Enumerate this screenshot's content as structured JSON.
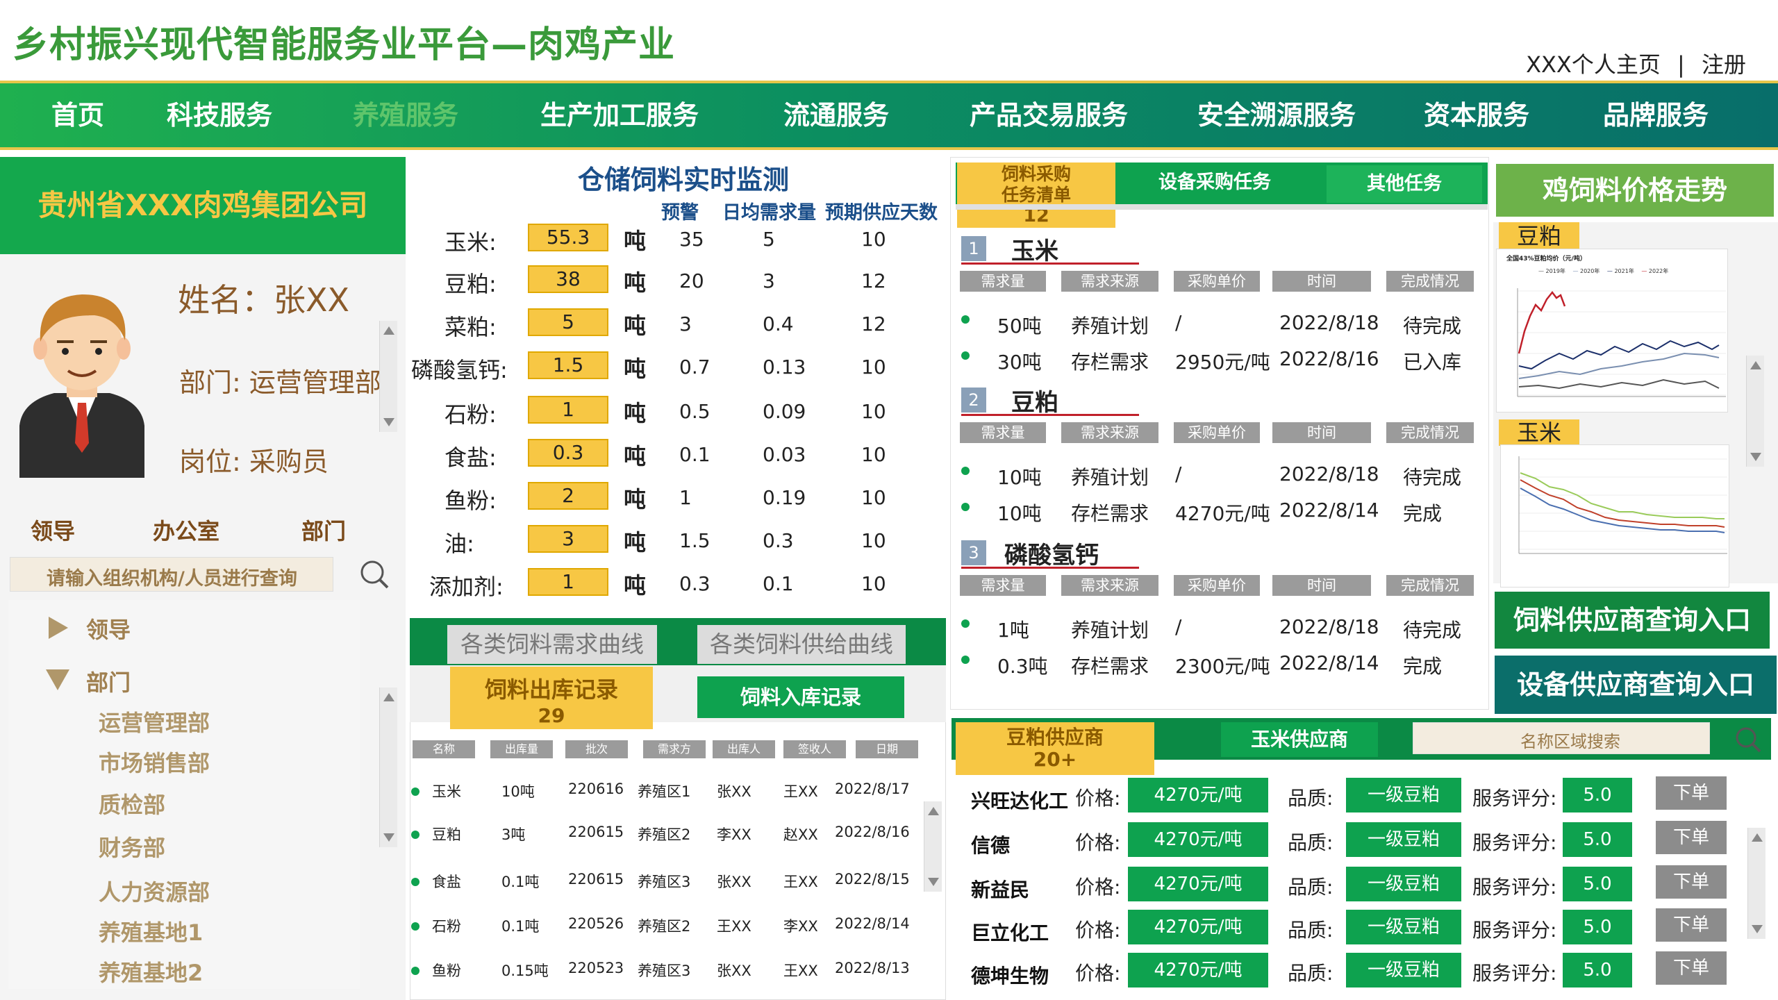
{
  "header": {
    "title": "乡村振兴现代智能服务业平台—肉鸡产业",
    "home_link": "XXX个人主页",
    "separator": "|",
    "register": "注册"
  },
  "nav": [
    "首页",
    "科技服务",
    "养殖服务",
    "生产加工服务",
    "流通服务",
    "产品交易服务",
    "安全溯源服务",
    "资本服务",
    "品牌服务"
  ],
  "company": "贵州省XXX肉鸡集团公司",
  "profile": {
    "name": "姓名：张XX",
    "dept": "部门: 运营管理部",
    "role": "岗位: 采购员"
  },
  "org_tabs": [
    "领导",
    "办公室",
    "部门"
  ],
  "search_placeholder": "请输入组织机构/人员进行查询",
  "tree": {
    "leader": "领导",
    "dept": "部门",
    "children": [
      "运营管理部",
      "市场销售部",
      "质检部",
      "财务部",
      "人力资源部",
      "养殖基地1",
      "养殖基地2"
    ]
  },
  "warehouse": {
    "title": "仓储饲料实时监测",
    "cols": [
      "预警",
      "日均需求量",
      "预期供应天数"
    ],
    "unit": "吨",
    "rows": [
      {
        "name": "玉米:",
        "qty": "55.3",
        "warn": "35",
        "daily": "5",
        "days": "10"
      },
      {
        "name": "豆粕:",
        "qty": "38",
        "warn": "20",
        "daily": "3",
        "days": "12"
      },
      {
        "name": "菜粕:",
        "qty": "5",
        "warn": "3",
        "daily": "0.4",
        "days": "12"
      },
      {
        "name": "磷酸氢钙:",
        "qty": "1.5",
        "warn": "0.7",
        "daily": "0.13",
        "days": "10"
      },
      {
        "name": "石粉:",
        "qty": "1",
        "warn": "0.5",
        "daily": "0.09",
        "days": "10"
      },
      {
        "name": "食盐:",
        "qty": "0.3",
        "warn": "0.1",
        "daily": "0.03",
        "days": "10"
      },
      {
        "name": "鱼粉:",
        "qty": "2",
        "warn": "1",
        "daily": "0.19",
        "days": "10"
      },
      {
        "name": "油:",
        "qty": "3",
        "warn": "1.5",
        "daily": "0.3",
        "days": "10"
      },
      {
        "name": "添加剂:",
        "qty": "1",
        "warn": "0.3",
        "daily": "0.1",
        "days": "10"
      }
    ]
  },
  "curves": {
    "demand": "各类饲料需求曲线",
    "supply": "各类饲料供给曲线"
  },
  "records": {
    "out_tab": "饲料出库记录",
    "out_count": "29",
    "in_tab": "饲料入库记录",
    "cols": [
      "名称",
      "出库量",
      "批次",
      "需求方",
      "出库人",
      "签收人",
      "日期"
    ],
    "rows": [
      [
        "玉米",
        "10吨",
        "220616",
        "养殖区1",
        "张XX",
        "王XX",
        "2022/8/17"
      ],
      [
        "豆粕",
        "3吨",
        "220615",
        "养殖区2",
        "李XX",
        "赵XX",
        "2022/8/16"
      ],
      [
        "食盐",
        "0.1吨",
        "220615",
        "养殖区3",
        "张XX",
        "王XX",
        "2022/8/15"
      ],
      [
        "石粉",
        "0.1吨",
        "220526",
        "养殖区2",
        "王XX",
        "李XX",
        "2022/8/14"
      ],
      [
        "鱼粉",
        "0.15吨",
        "220523",
        "养殖区3",
        "张XX",
        "王XX",
        "2022/8/13"
      ]
    ]
  },
  "tasks": {
    "tab1": "饲料采购\n任务清单",
    "tab1_count": "12",
    "tab2": "设备采购任务",
    "tab3": "其他任务",
    "cols": [
      "需求量",
      "需求来源",
      "采购单价",
      "时间",
      "完成情况"
    ],
    "groups": [
      {
        "num": "1",
        "name": "玉米",
        "rows": [
          [
            "50吨",
            "养殖计划",
            "/",
            "2022/8/18",
            "待完成"
          ],
          [
            "30吨",
            "存栏需求",
            "2950元/吨",
            "2022/8/16",
            "已入库"
          ]
        ]
      },
      {
        "num": "2",
        "name": "豆粕",
        "rows": [
          [
            "10吨",
            "养殖计划",
            "/",
            "2022/8/18",
            "待完成"
          ],
          [
            "10吨",
            "存栏需求",
            "4270元/吨",
            "2022/8/14",
            "完成"
          ]
        ]
      },
      {
        "num": "3",
        "name": "磷酸氢钙",
        "rows": [
          [
            "1吨",
            "养殖计划",
            "/",
            "2022/8/18",
            "待完成"
          ],
          [
            "0.3吨",
            "存栏需求",
            "2300元/吨",
            "2022/8/14",
            "完成"
          ]
        ]
      }
    ]
  },
  "suppliers": {
    "tab1": "豆粕供应商",
    "tab1_count": "20+",
    "tab2": "玉米供应商",
    "search_placeholder": "名称区域搜索",
    "price_label": "价格:",
    "quality_label": "品质:",
    "score_label": "服务评分:",
    "order": "下单",
    "rows": [
      {
        "name": "兴旺达化工",
        "price": "4270元/吨",
        "quality": "一级豆粕",
        "score": "5.0"
      },
      {
        "name": "信德",
        "price": "4270元/吨",
        "quality": "一级豆粕",
        "score": "5.0"
      },
      {
        "name": "新益民",
        "price": "4270元/吨",
        "quality": "一级豆粕",
        "score": "5.0"
      },
      {
        "name": "巨立化工",
        "price": "4270元/吨",
        "quality": "一级豆粕",
        "score": "5.0"
      },
      {
        "name": "德坤生物",
        "price": "4270元/吨",
        "quality": "一级豆粕",
        "score": "5.0"
      }
    ]
  },
  "price_trend": {
    "title": "鸡饲料价格走势",
    "soy_label": "豆粕",
    "corn_label": "玉米",
    "soy_chart_title": "全国43%豆粕均价（元/吨）",
    "soy_legend": [
      "2019年",
      "2020年",
      "2021年",
      "2022年"
    ]
  },
  "entry": {
    "feed": "饲料供应商查询入口",
    "equip": "设备供应商查询入口"
  },
  "colors": {
    "green": "#0ea24f",
    "yellow": "#f7c744",
    "teal": "#086e6a"
  }
}
